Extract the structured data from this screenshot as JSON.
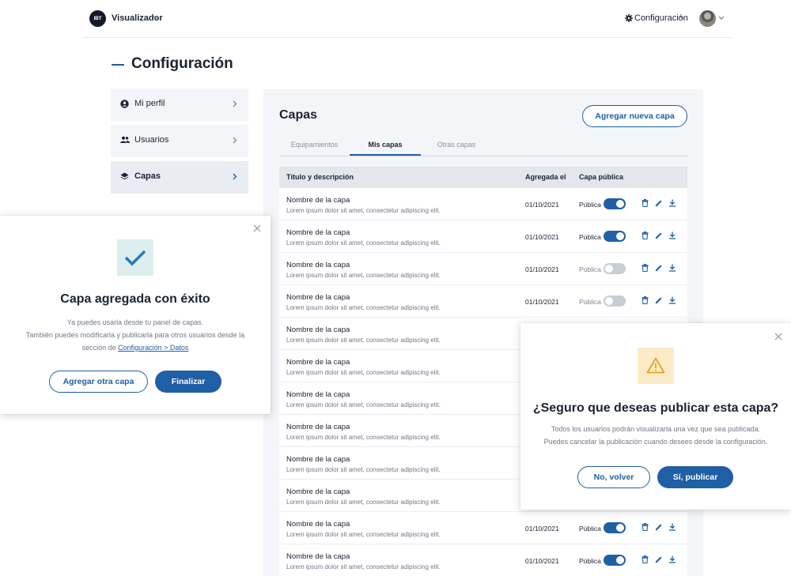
{
  "header": {
    "brand_logo": "IBT",
    "brand_name": "Visualizador",
    "config_label": "Configuración"
  },
  "page": {
    "title": "Configuración"
  },
  "sidebar": {
    "items": [
      {
        "label": "Mi perfil",
        "icon": "user-circle-icon"
      },
      {
        "label": "Usuarios",
        "icon": "users-icon"
      },
      {
        "label": "Capas",
        "icon": "layers-icon",
        "active": true
      }
    ]
  },
  "main": {
    "title": "Capas",
    "add_button": "Agregar nueva capa",
    "tabs": [
      {
        "label": "Equipamientos"
      },
      {
        "label": "Mis capas",
        "active": true
      },
      {
        "label": "Otras capas"
      }
    ],
    "columns": {
      "title": "Título y descripción",
      "date": "Agregada el",
      "public": "Capa pública"
    },
    "rows": [
      {
        "name": "Nombre de la capa",
        "desc": "Lorem ipsum dolor sit amet, consectetur adipiscing elit.",
        "date": "01/10/2021",
        "status": "Pública",
        "public": true
      },
      {
        "name": "Nombre de la capa",
        "desc": "Lorem ipsum dolor sit amet, consectetur adipiscing elit.",
        "date": "01/10/2021",
        "status": "Pública",
        "public": true
      },
      {
        "name": "Nombre de la capa",
        "desc": "Lorem ipsum dolor sit amet, consectetur adipiscing elit.",
        "date": "01/10/2021",
        "status": "Pública",
        "public": false
      },
      {
        "name": "Nombre de la capa",
        "desc": "Lorem ipsum dolor sit amet, consectetur adipiscing elit.",
        "date": "01/10/2021",
        "status": "Pública",
        "public": false
      },
      {
        "name": "Nombre de la capa",
        "desc": "Lorem ipsum dolor sit amet, consectetur adipiscing elit."
      },
      {
        "name": "Nombre de la capa",
        "desc": "Lorem ipsum dolor sit amet, consectetur adipiscing elit."
      },
      {
        "name": "Nombre de la capa",
        "desc": "Lorem ipsum dolor sit amet, consectetur adipiscing elit."
      },
      {
        "name": "Nombre de la capa",
        "desc": "Lorem ipsum dolor sit amet, consectetur adipiscing elit."
      },
      {
        "name": "Nombre de la capa",
        "desc": "Lorem ipsum dolor sit amet, consectetur adipiscing elit."
      },
      {
        "name": "Nombre de la capa",
        "desc": "Lorem ipsum dolor sit amet, consectetur adipiscing elit."
      },
      {
        "name": "Nombre de la capa",
        "desc": "Lorem ipsum dolor sit amet, consectetur adipiscing elit.",
        "date": "01/10/2021",
        "status": "Pública",
        "public": true
      },
      {
        "name": "Nombre de la capa",
        "desc": "Lorem ipsum dolor sit amet, consectetur adipiscing elit.",
        "date": "01/10/2021",
        "status": "Pública",
        "public": true
      }
    ]
  },
  "success_modal": {
    "title": "Capa agregada con éxito",
    "line1": "Ya puedes usarla desde tu panel de capas.",
    "line2": "También puedes modificarla y publicarla para otros usuarios desde la",
    "line3_prefix": "sección de ",
    "line3_link": "Configuración > Datos",
    "secondary_button": "Agregar otra capa",
    "primary_button": "Finalizar"
  },
  "confirm_modal": {
    "title": "¿Seguro que deseas publicar esta capa?",
    "line1": "Todos los usuarios podrán visualizarla una vez que sea publicada.",
    "line2": "Puedes cancelar la publicación cuando desees desde la configuración.",
    "cancel_button": "No, volver",
    "confirm_button": "Sí, publicar"
  },
  "colors": {
    "primary": "#1f5fa6",
    "success_bg": "#dcefef",
    "check": "#2b7ab8",
    "warning_bg": "#fdebc8",
    "warning": "#e8a21a"
  }
}
